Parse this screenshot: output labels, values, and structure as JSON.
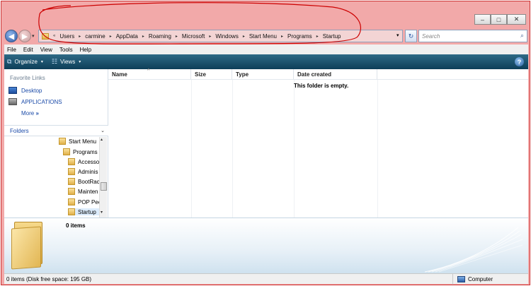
{
  "window": {
    "controls": [
      "minimize",
      "maximize",
      "close"
    ],
    "minimize_glyph": "–",
    "maximize_glyph": "□",
    "close_glyph": "✕"
  },
  "nav": {
    "back_glyph": "◀",
    "forward_glyph": "▶",
    "history_glyph": "▾"
  },
  "address": {
    "prefix": "«",
    "breadcrumbs": [
      "Users",
      "carmine",
      "AppData",
      "Roaming",
      "Microsoft",
      "Windows",
      "Start Menu",
      "Programs",
      "Startup"
    ],
    "separator": "▸",
    "dropdown_glyph": "▾",
    "refresh_glyph": "↻"
  },
  "search": {
    "placeholder": "Search",
    "icon": "magnifier-icon",
    "icon_glyph": "⌕"
  },
  "menubar": {
    "items": [
      {
        "label": "File"
      },
      {
        "label": "Edit"
      },
      {
        "label": "View"
      },
      {
        "label": "Tools"
      },
      {
        "label": "Help"
      }
    ]
  },
  "commandbar": {
    "organize": "Organize",
    "views": "Views",
    "help_glyph": "?",
    "dropdown_glyph": "▾",
    "organize_icon_glyph": "⧉",
    "views_icon_glyph": "☷"
  },
  "navpane": {
    "favorites_title": "Favorite Links",
    "favorites": [
      {
        "label": "Desktop"
      },
      {
        "label": "APPLICATIONS"
      }
    ],
    "more_label": "More",
    "more_glyph": "»",
    "folders_label": "Folders",
    "folders_glyph": "⌄",
    "tree": [
      {
        "label": "Start Menu"
      },
      {
        "label": "Programs"
      },
      {
        "label": "Accesso"
      },
      {
        "label": "Adminis"
      },
      {
        "label": "BootRac"
      },
      {
        "label": "Mainten"
      },
      {
        "label": "POP Pee"
      },
      {
        "label": "Startup"
      }
    ],
    "scroll_down_glyph": "▾",
    "scroll_up_glyph": "▴"
  },
  "filelist": {
    "columns": [
      "Name",
      "Size",
      "Type",
      "Date created"
    ],
    "sort_glyph": "^",
    "empty_message": "This folder is empty."
  },
  "details": {
    "items_count": "0 items"
  },
  "status": {
    "left": "0 items (Disk free space: 195 GB)",
    "right": "Computer"
  },
  "colors": {
    "frame": "#f2a9a9",
    "command_bar": "#1d5573",
    "link": "#1a4aa8",
    "annotation": "#cc0000"
  }
}
